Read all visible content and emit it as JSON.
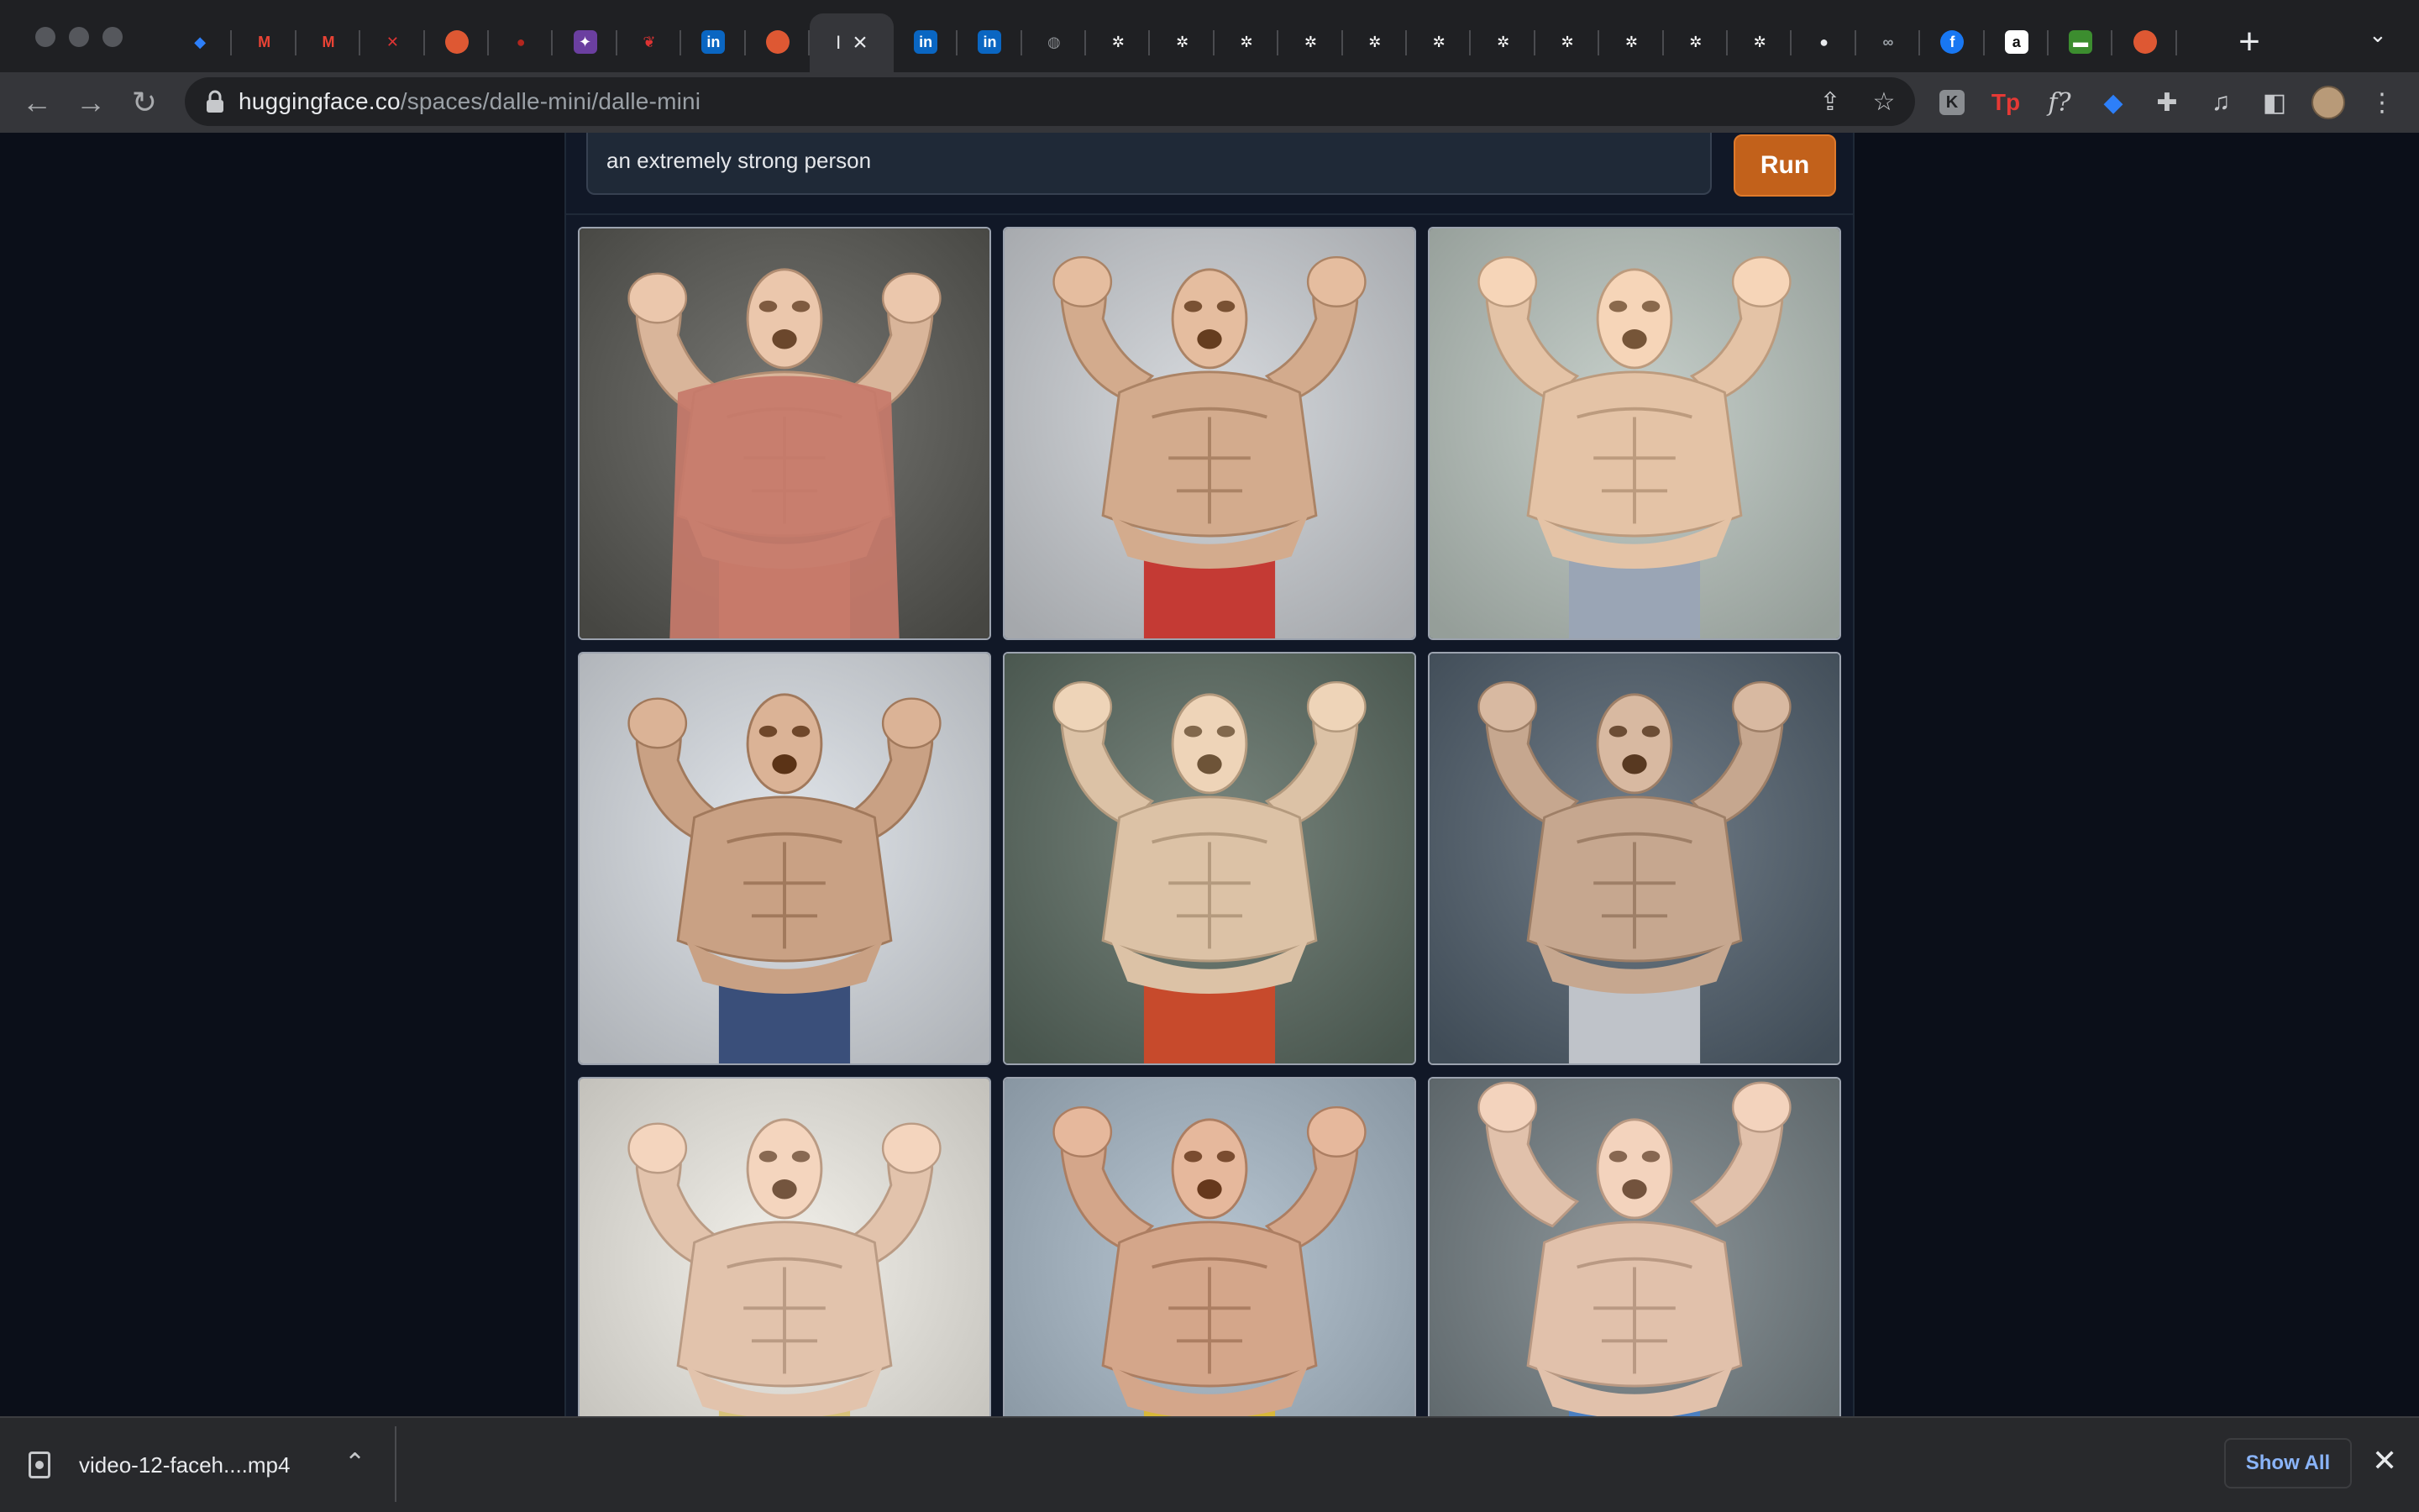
{
  "browser": {
    "tabs": [
      {
        "icon": "sapphire-icon",
        "color": "#2d7ff9",
        "glyph": "◆"
      },
      {
        "icon": "gmail-icon",
        "color": "#ea4335",
        "glyph": "M"
      },
      {
        "icon": "gmail-icon",
        "color": "#ea4335",
        "glyph": "M"
      },
      {
        "icon": "bookmark-flag-icon",
        "color": "#d33",
        "glyph": "✕"
      },
      {
        "icon": "duckduckgo-icon",
        "color": "#de5833",
        "glyph": "●"
      },
      {
        "icon": "red-dot-icon",
        "color": "#b3261e",
        "glyph": "●"
      },
      {
        "icon": "purple-app-icon",
        "color": "#6b3fa0",
        "glyph": "✦"
      },
      {
        "icon": "red-bird-icon",
        "color": "#d33",
        "glyph": "❦"
      },
      {
        "icon": "linkedin-icon",
        "color": "#0a66c2",
        "glyph": "in"
      },
      {
        "icon": "duckduckgo-icon",
        "color": "#de5833",
        "glyph": "●"
      },
      {
        "icon": "linkedin-icon",
        "color": "#0a66c2",
        "glyph": "in"
      },
      {
        "icon": "linkedin-icon",
        "color": "#0a66c2",
        "glyph": "in"
      },
      {
        "icon": "globe-icon",
        "color": "#8a8d91",
        "glyph": "◍"
      },
      {
        "icon": "gear-favicon-icon",
        "color": "#ffffff",
        "glyph": "✲"
      },
      {
        "icon": "gear-favicon-icon",
        "color": "#ffffff",
        "glyph": "✲"
      },
      {
        "icon": "gear-favicon-icon",
        "color": "#ffffff",
        "glyph": "✲"
      },
      {
        "icon": "gear-favicon-icon",
        "color": "#ffffff",
        "glyph": "✲"
      },
      {
        "icon": "gear-favicon-icon",
        "color": "#ffffff",
        "glyph": "✲"
      },
      {
        "icon": "gear-favicon-icon",
        "color": "#ffffff",
        "glyph": "✲"
      },
      {
        "icon": "gear-favicon-icon",
        "color": "#ffffff",
        "glyph": "✲"
      },
      {
        "icon": "gear-favicon-icon",
        "color": "#ffffff",
        "glyph": "✲"
      },
      {
        "icon": "gear-favicon-icon",
        "color": "#ffffff",
        "glyph": "✲"
      },
      {
        "icon": "gear-favicon-icon",
        "color": "#ffffff",
        "glyph": "✲"
      },
      {
        "icon": "gear-favicon-icon",
        "color": "#ffffff",
        "glyph": "✲"
      },
      {
        "icon": "github-icon",
        "color": "#e8eaed",
        "glyph": "●"
      },
      {
        "icon": "infinity-icon",
        "color": "#9aa0a6",
        "glyph": "∞"
      },
      {
        "icon": "facebook-icon",
        "color": "#1877f2",
        "glyph": "f"
      },
      {
        "icon": "amazon-icon",
        "color": "#ffffff",
        "glyph": "a"
      },
      {
        "icon": "green-card-icon",
        "color": "#3c8d2f",
        "glyph": "▬"
      },
      {
        "icon": "duckduckgo-icon",
        "color": "#de5833",
        "glyph": "●"
      }
    ],
    "active_tab": {
      "title": "I"
    },
    "url_domain": "huggingface.co",
    "url_path": "/spaces/dalle-mini/dalle-mini"
  },
  "app": {
    "prompt_value": "an extremely strong person",
    "run_label": "Run",
    "images": [
      {
        "name": "generated-image-1",
        "bg": "#5a5a56",
        "skin": "#d9b59a",
        "shirt": "#c77a6a"
      },
      {
        "name": "generated-image-2",
        "bg": "#b9bcc0",
        "skin": "#d3ab8d",
        "shirt": "#c43a34"
      },
      {
        "name": "generated-image-3",
        "bg": "#a9b2ad",
        "skin": "#e4c3a6",
        "shirt": "#9aa5b5"
      },
      {
        "name": "generated-image-4",
        "bg": "#c3c7cc",
        "skin": "#c9a184",
        "shirt": "#3a4f7a"
      },
      {
        "name": "generated-image-5",
        "bg": "#5c6961",
        "skin": "#dcc2a6",
        "shirt": "#c74a2c"
      },
      {
        "name": "generated-image-6",
        "bg": "#54606b",
        "skin": "#c6a78f",
        "shirt": "#bfc3c9"
      },
      {
        "name": "generated-image-7",
        "bg": "#d5d3cd",
        "skin": "#e2c3ac",
        "shirt": "#d7c27a"
      },
      {
        "name": "generated-image-8",
        "bg": "#9aa8b4",
        "skin": "#d4a68a",
        "shirt": "#d8b83a"
      },
      {
        "name": "generated-image-9",
        "bg": "#6f787c",
        "skin": "#e1c1ab",
        "shirt": "#4a7fc2"
      }
    ]
  },
  "downloads": {
    "file_name": "video-12-faceh....mp4",
    "show_all_label": "Show All"
  }
}
